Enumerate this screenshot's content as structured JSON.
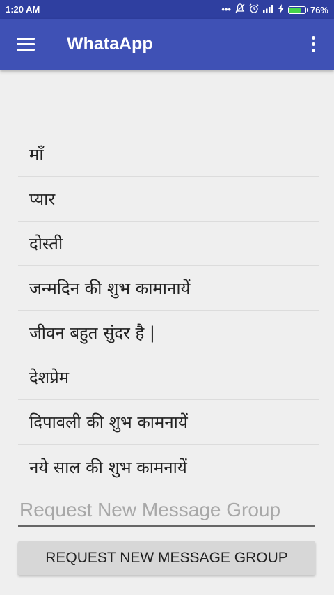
{
  "status_bar": {
    "time": "1:20 AM",
    "battery_percent": "76%",
    "battery_level": 0.76,
    "icons": [
      "more-dots-icon",
      "notifications-off-icon",
      "alarm-icon",
      "signal-icon",
      "charging-icon",
      "battery-icon"
    ]
  },
  "app_bar": {
    "title": "WhataApp",
    "nav_icon": "hamburger-menu-icon",
    "overflow_icon": "more-vertical-icon"
  },
  "categories": [
    {
      "label": "माँ"
    },
    {
      "label": "प्यार"
    },
    {
      "label": "दोस्ती"
    },
    {
      "label": "जन्मदिन की शुभ कामानायें"
    },
    {
      "label": "जीवन बहुत सुंदर है |"
    },
    {
      "label": "देशप्रेम"
    },
    {
      "label": "दिपावली की शुभ कामनायें"
    },
    {
      "label": "नये साल की शुभ कामनायें"
    }
  ],
  "request": {
    "input_value": "",
    "input_placeholder": "Request New Message Group",
    "button_label": "REQUEST NEW MESSAGE GROUP"
  },
  "colors": {
    "app_bar": "#3f51b5",
    "status_bar": "#2f3fa0",
    "background": "#efefef",
    "battery_fill": "#46d34b"
  }
}
